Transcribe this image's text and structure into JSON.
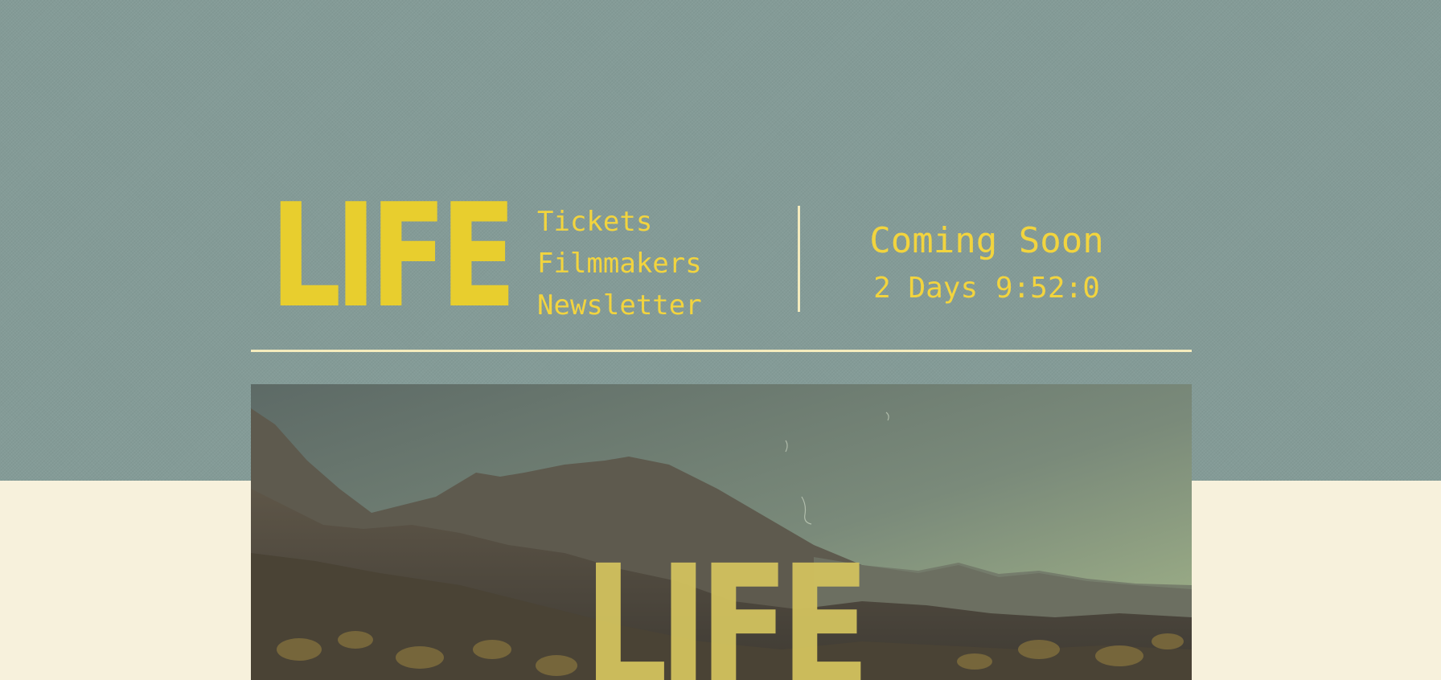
{
  "site": {
    "logo_text": "LIFE"
  },
  "nav": {
    "items": [
      {
        "label": "Tickets"
      },
      {
        "label": "Filmmakers"
      },
      {
        "label": "Newsletter"
      }
    ]
  },
  "release": {
    "status": "Coming Soon",
    "countdown": "2 Days 9:52:0"
  },
  "hero": {
    "title": "LIFE"
  },
  "colors": {
    "header_background": "#849b97",
    "page_background": "#f7f1dc",
    "accent_yellow": "#f2d43e",
    "divider": "#f4ebbd"
  }
}
